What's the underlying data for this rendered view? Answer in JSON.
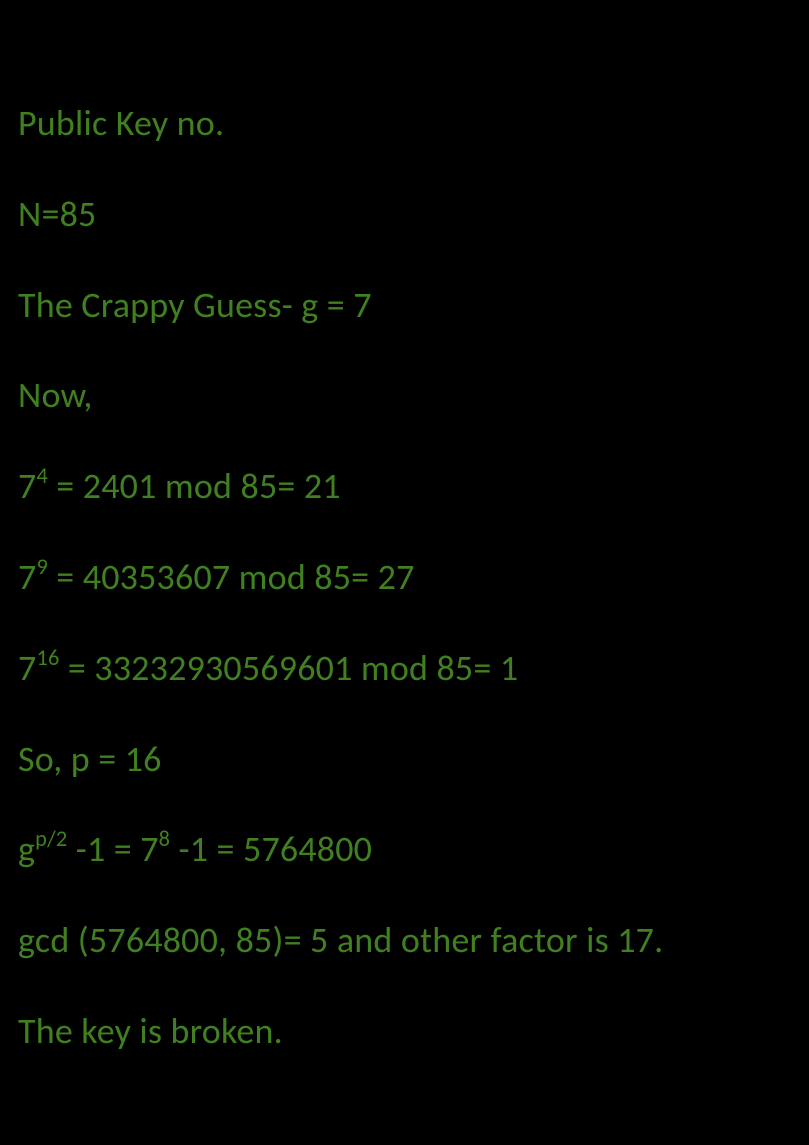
{
  "lines": {
    "l1": "Public Key no.",
    "l2": "N=85",
    "l3": "The Crappy Guess- g = 7",
    "l4": "Now,",
    "l5_base": "7",
    "l5_exp": "4",
    "l5_rest": " = 2401 mod 85= 21",
    "l6_base": "7",
    "l6_exp": "9",
    "l6_rest": " = 40353607 mod 85= 27",
    "l7_base": "7",
    "l7_exp": "16",
    "l7_rest": " = 33232930569601 mod 85= 1",
    "l8": "So, p = 16",
    "l9_a": "g",
    "l9_exp1": "p/2",
    "l9_b": " -1 = 7",
    "l9_exp2": "8",
    "l9_c": " -1 = 5764800",
    "l10": "gcd (5764800, 85)= 5 and other factor is 17.",
    "l11": "The key is broken."
  }
}
